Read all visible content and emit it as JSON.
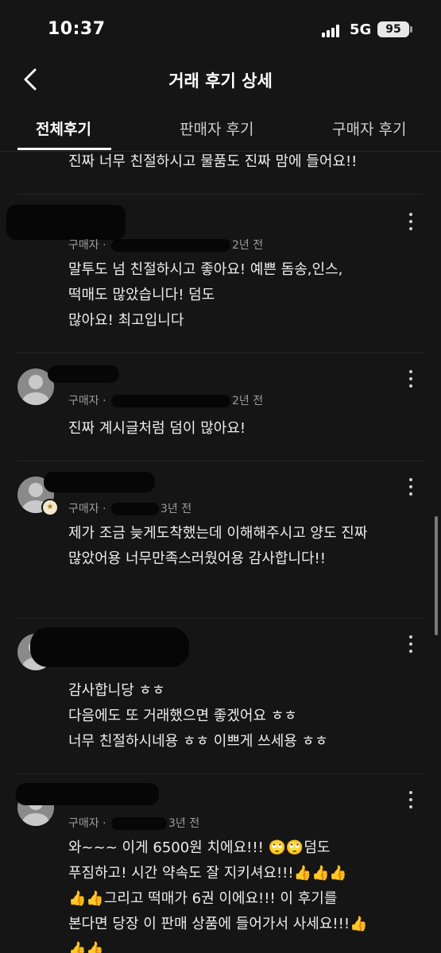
{
  "status_bar": {
    "time": "10:37",
    "network": "5G",
    "battery": "95"
  },
  "header": {
    "title": "거래 후기 상세",
    "back_icon": "chevron-left-icon"
  },
  "tabs": [
    {
      "label": "전체후기",
      "active": true
    },
    {
      "label": "판매자 후기",
      "active": false
    },
    {
      "label": "구매자 후기",
      "active": false
    }
  ],
  "reviews": [
    {
      "meta_role": "",
      "meta_suffix": "",
      "text": "진짜 너무 친절하시고 물품도 진짜 맘에 들어요!!"
    },
    {
      "meta_role": "구매자 · ",
      "meta_suffix": "2년 전",
      "text": "말투도 넘 친절하시고 좋아요! 예쁜 돔송,인스,\n떡매도 많았습니다! 덤도\n많아요! 최고입니다"
    },
    {
      "meta_role": "구매자 · ",
      "meta_suffix": "2년 전",
      "text": "진짜 계시글처럼 덤이 많아요!"
    },
    {
      "meta_role": "구매자 · ",
      "meta_suffix": "3년 전",
      "text": "제가 조금 늦게도착했는데 이해해주시고 양도 진짜\n많았어용 너무만족스러웠어용 감사합니다!!"
    },
    {
      "meta_role": "",
      "meta_suffix": "",
      "text": "감사합니당 ㅎㅎ\n다음에도 또 거래했으면 좋겠어요 ㅎㅎ\n너무 친절하시네용 ㅎㅎ 이쁘게 쓰세용 ㅎㅎ"
    },
    {
      "meta_role": "구매자 · ",
      "meta_suffix": "3년 전",
      "text": "와~~~ 이게 6500원 치에요!!! 🙄🙄덤도\n푸짐하고! 시간 약속도 잘 지키셔요!!!👍👍👍\n👍👍그리고 떡매가 6권 이에요!!! 이 후기를\n본다면 당장 이 판매 상품에 들어가서 사세요!!!👍\n👍👍"
    }
  ],
  "colors": {
    "background": "#151515",
    "text": "#ededed",
    "meta": "#9c9c9c"
  }
}
